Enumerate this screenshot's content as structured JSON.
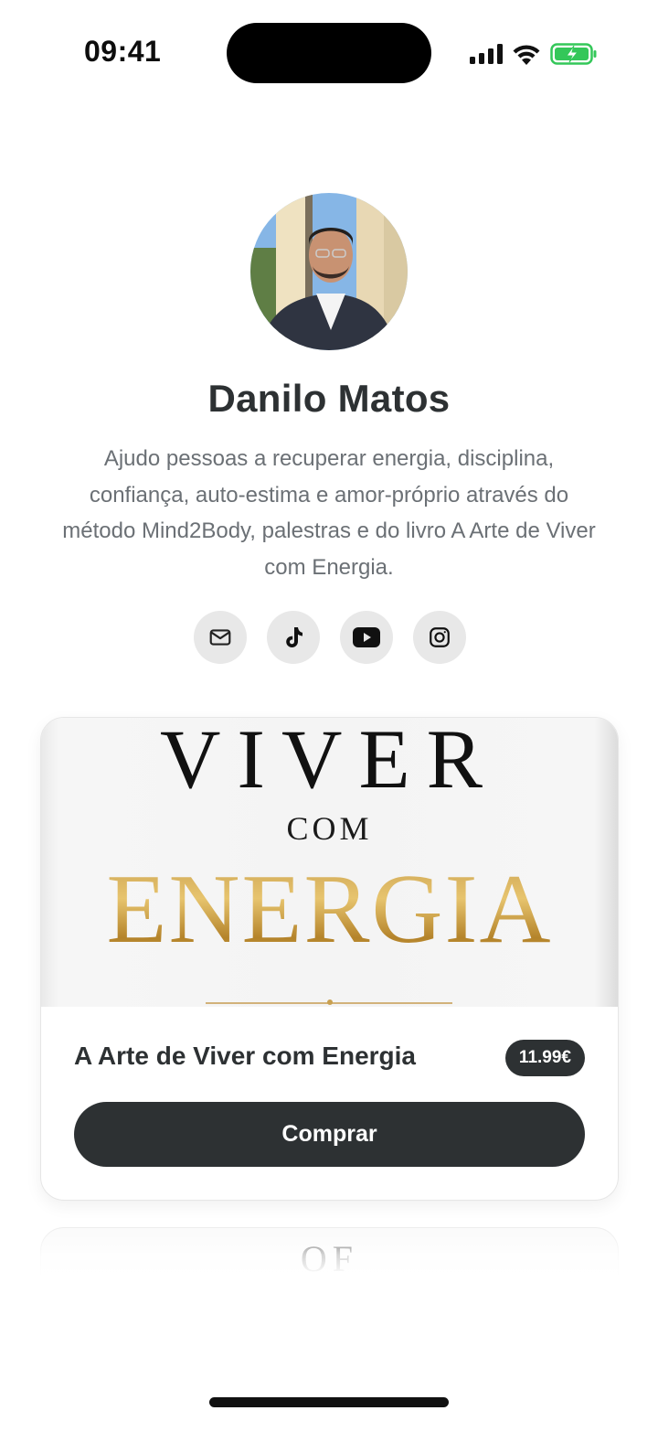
{
  "status_bar": {
    "time": "09:41",
    "icons": [
      "signal-icon",
      "wifi-icon",
      "battery-charging-icon"
    ],
    "battery_color": "#34c759"
  },
  "profile": {
    "name": "Danilo Matos",
    "bio": "Ajudo pessoas a recuperar energia, disciplina, confiança, auto-estima e amor-próprio através do método Mind2Body, palestras e do livro A Arte de Viver com Energia.",
    "avatar_icon": "profile-photo"
  },
  "socials": [
    {
      "icon": "mail-icon"
    },
    {
      "icon": "tiktok-icon"
    },
    {
      "icon": "youtube-icon"
    },
    {
      "icon": "instagram-icon"
    }
  ],
  "product": {
    "cover": {
      "line1": "VIVER",
      "line2": "COM",
      "line3": "ENERGIA"
    },
    "title": "A Arte de Viver com Energia",
    "price": "11.99€",
    "button_label": "Comprar"
  },
  "next_card": {
    "cover_text": "OF"
  },
  "colors": {
    "primary_dark": "#2d3133",
    "muted_text": "#6b7075",
    "social_bg": "#e8e8e8",
    "gold": "#c9a050"
  }
}
